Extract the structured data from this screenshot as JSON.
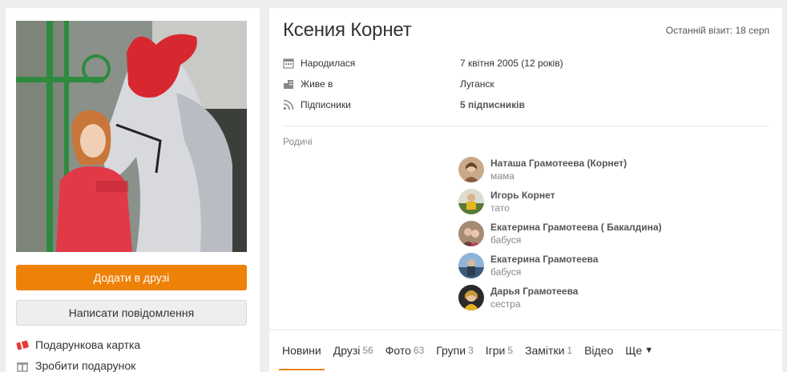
{
  "profile": {
    "name": "Ксения Корнет",
    "last_visit": "Останній візит: 18 серп"
  },
  "actions": {
    "add_friend": "Додати в друзі",
    "write_message": "Написати повідомлення"
  },
  "side_links": [
    {
      "label": "Подарункова картка",
      "icon": "gift-card-icon"
    },
    {
      "label": "Зробити подарунок",
      "icon": "gift-icon"
    }
  ],
  "info": [
    {
      "label": "Народилася",
      "value": "7 квітня 2005 (12 років)",
      "icon": "calendar-icon"
    },
    {
      "label": "Живе в",
      "value": "Луганск",
      "icon": "location-icon"
    },
    {
      "label": "Підписники",
      "value": "5 підписників",
      "icon": "subscribers-icon"
    }
  ],
  "relatives": {
    "title": "Родичі",
    "items": [
      {
        "name": "Наташа Грамотеева (Корнет)",
        "role": "мама"
      },
      {
        "name": "Игорь Корнет",
        "role": "тато"
      },
      {
        "name": "Екатерина Грамотеева ( Бакалдина)",
        "role": "бабуся"
      },
      {
        "name": "Екатерина Грамотеева",
        "role": "бабуся"
      },
      {
        "name": "Дарья Грамотеева",
        "role": "сестра"
      }
    ]
  },
  "tabs": [
    {
      "label": "Новини",
      "count": ""
    },
    {
      "label": "Друзі",
      "count": "56"
    },
    {
      "label": "Фото",
      "count": "63"
    },
    {
      "label": "Групи",
      "count": "3"
    },
    {
      "label": "Ігри",
      "count": "5"
    },
    {
      "label": "Замітки",
      "count": "1"
    },
    {
      "label": "Відео",
      "count": ""
    },
    {
      "label": "Ще",
      "count": ""
    }
  ],
  "colors": {
    "accent": "#ee8208",
    "background": "#eeeeee"
  }
}
